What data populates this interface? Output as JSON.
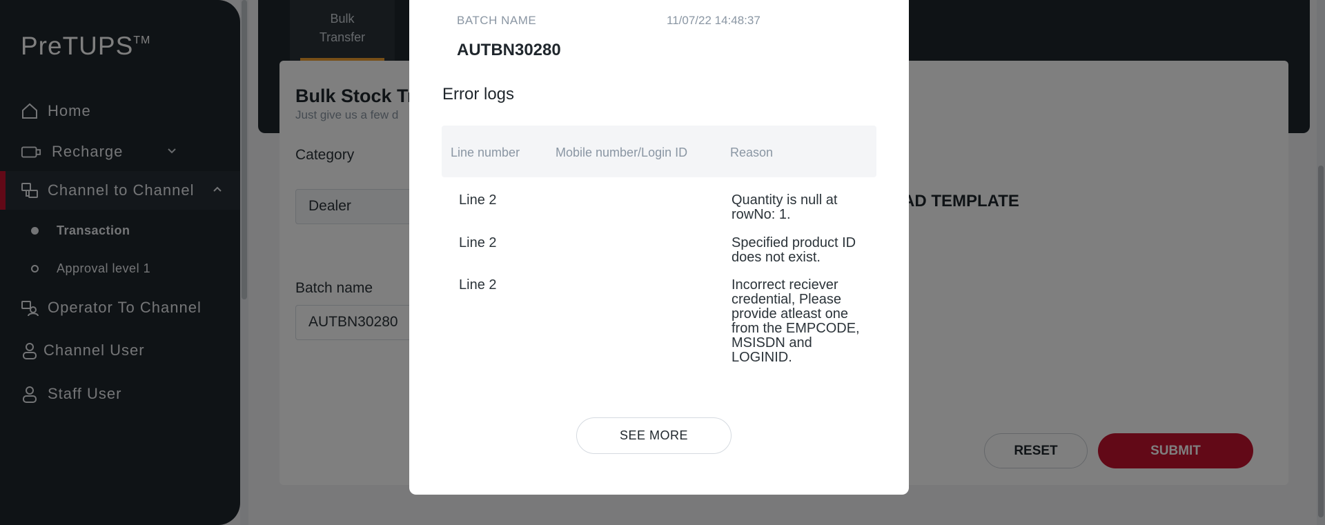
{
  "app": {
    "logo": "PreTUPS",
    "logo_tm": "TM"
  },
  "sidebar": {
    "items": [
      {
        "label": "Home",
        "icon": "home-icon"
      },
      {
        "label": "Recharge",
        "icon": "recharge-icon",
        "chevron": "⌄"
      },
      {
        "label": "Channel to Channel",
        "icon": "channel-transfer-icon",
        "chevron": "⌃",
        "active": true
      },
      {
        "label": "Operator To Channel",
        "icon": "operator-channel-icon"
      },
      {
        "label": "Channel User",
        "icon": "user-icon"
      },
      {
        "label": "Staff User",
        "icon": "user-icon"
      }
    ],
    "sub_items": [
      {
        "label": "Transaction",
        "active": true
      },
      {
        "label": "Approval level 1",
        "active": false
      }
    ]
  },
  "background": {
    "tab_label": "Bulk Transfer",
    "panel_title": "Bulk Stock Tra",
    "panel_subtitle": "Just give us a few d",
    "category_label": "Category",
    "category_value": "Dealer",
    "batch_name_label": "Batch name",
    "batch_name_value": "AUTBN30280",
    "download_template": "AD TEMPLATE",
    "reset_label": "RESET",
    "submit_label": "SUBMIT"
  },
  "modal": {
    "batch_name_label": "BATCH NAME",
    "datetime": "11/07/22 14:48:37",
    "batch_name_value": "AUTBN30280",
    "error_title": "Error logs",
    "columns": [
      "Line number",
      "Mobile number/Login ID",
      "Reason"
    ],
    "rows": [
      {
        "line": "Line 2",
        "mobile": "",
        "reason": "Quantity is null at rowNo: 1."
      },
      {
        "line": "Line 2",
        "mobile": "",
        "reason": "Specified product ID does not exist."
      },
      {
        "line": "Line 2",
        "mobile": "",
        "reason": "Incorrect reciever credential, Please provide atleast one from the EMPCODE, MSISDN and LOGINID."
      }
    ],
    "see_more_label": "SEE MORE"
  },
  "colors": {
    "sidebar_bg": "#1f262c",
    "accent_red": "#c4122f",
    "tab_underline": "#f0a030"
  }
}
